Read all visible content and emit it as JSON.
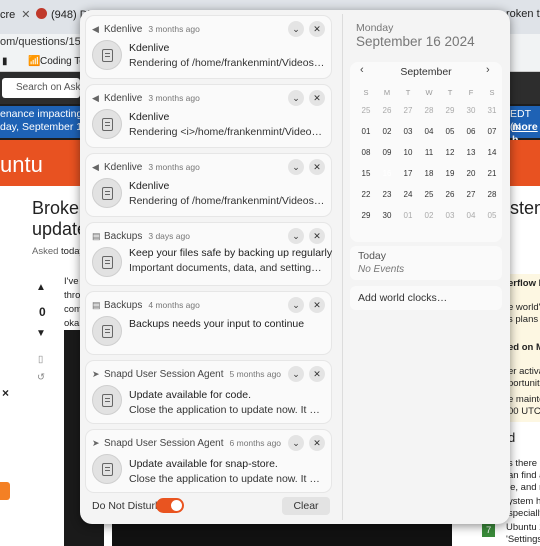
{
  "background": {
    "tabs": [
      {
        "label": "cre",
        "close": "✕"
      },
      {
        "label": "(948) Di"
      },
      {
        "label": "roken te"
      }
    ],
    "url_text": "om/questions/1527",
    "bookmark_coding": "Coding Te",
    "site_search": "Search on Ask Ub",
    "banner_line1": "enance impacting St",
    "banner_line2": "day, September 17, 2",
    "banner_right1": "EDT (N",
    "banner_right2": "more h",
    "ubuntu_text": "untu",
    "question_title_left1": "Broken",
    "question_title_left2": "update",
    "question_title_right": "stem",
    "asked_label": "Asked",
    "asked_value": "today",
    "vote_count": "0",
    "post_frag1": "I've",
    "post_frag2": "thro",
    "post_frag3": "com",
    "post_frag4": "oka",
    "side1a": "erflow B",
    "side1b": "e world's",
    "side1c": "s plans fo",
    "side2a": "ed on Me",
    "side3a": "er activa",
    "side3b": "portuniti",
    "side4a": "e mainte",
    "side4b": "00 UTC",
    "side5a": "d",
    "side6a": "s there a",
    "side6b": "an find a",
    "side6c": "le, and re",
    "side7a": "ystem ha",
    "side7b": "specially",
    "side8_count": "7",
    "side8a": "Ubuntu 24",
    "side8b": "'Settings'",
    "x_mark": "×"
  },
  "notifications": [
    {
      "app": "Kdenlive",
      "time": "3 months ago",
      "title": "Kdenlive",
      "body": "Rendering of /home/frankenmint/Videos/w4b...",
      "body2": ""
    },
    {
      "app": "Kdenlive",
      "time": "3 months ago",
      "title": "Kdenlive",
      "body": "Rendering <i>/home/frankenmint/Videos/w4b...",
      "body2": ""
    },
    {
      "app": "Kdenlive",
      "time": "3 months ago",
      "title": "Kdenlive",
      "body": "Rendering of /home/frankenmint/Videos/w4b...",
      "body2": ""
    },
    {
      "app": "Backups",
      "time": "3 days ago",
      "title": "Keep your files safe by backing up regularly",
      "body": "Important documents, data, and settings can ...",
      "body2": ""
    },
    {
      "app": "Backups",
      "time": "4 months ago",
      "title": "Backups needs your input to continue",
      "body": "",
      "body2": ""
    },
    {
      "app": "Snapd User Session Agent",
      "time": "5 months ago",
      "title": "Update available for code.",
      "body": "Close the application to update now. It will up...",
      "body2": ""
    },
    {
      "app": "Snapd User Session Agent",
      "time": "6 months ago",
      "title": "Update available for snap-store.",
      "body": "Close the application to update now. It will up...",
      "body2": ""
    }
  ],
  "footer": {
    "dnd_label": "Do Not Disturb",
    "clear_label": "Clear",
    "dnd_on": true
  },
  "calendar": {
    "day_name": "Monday",
    "full_date": "September 16 2024",
    "month": "September",
    "prev": "‹",
    "next": "›",
    "weekdays": [
      "S",
      "M",
      "T",
      "W",
      "T",
      "F",
      "S"
    ],
    "weeks": [
      [
        [
          "25",
          "other"
        ],
        [
          "26",
          "other"
        ],
        [
          "27",
          "other"
        ],
        [
          "28",
          "other"
        ],
        [
          "29",
          "other"
        ],
        [
          "30",
          "other"
        ],
        [
          "31",
          "other"
        ]
      ],
      [
        [
          "01",
          ""
        ],
        [
          "02",
          ""
        ],
        [
          "03",
          ""
        ],
        [
          "04",
          ""
        ],
        [
          "05",
          ""
        ],
        [
          "06",
          ""
        ],
        [
          "07",
          ""
        ]
      ],
      [
        [
          "08",
          ""
        ],
        [
          "09",
          ""
        ],
        [
          "10",
          ""
        ],
        [
          "11",
          ""
        ],
        [
          "12",
          ""
        ],
        [
          "13",
          ""
        ],
        [
          "14",
          ""
        ]
      ],
      [
        [
          "15",
          ""
        ],
        [
          "16",
          "today"
        ],
        [
          "17",
          ""
        ],
        [
          "18",
          ""
        ],
        [
          "19",
          ""
        ],
        [
          "20",
          ""
        ],
        [
          "21",
          ""
        ]
      ],
      [
        [
          "22",
          ""
        ],
        [
          "23",
          ""
        ],
        [
          "24",
          ""
        ],
        [
          "25",
          ""
        ],
        [
          "26",
          ""
        ],
        [
          "27",
          ""
        ],
        [
          "28",
          ""
        ]
      ],
      [
        [
          "29",
          ""
        ],
        [
          "30",
          ""
        ],
        [
          "01",
          "other"
        ],
        [
          "02",
          "other"
        ],
        [
          "03",
          "other"
        ],
        [
          "04",
          "other"
        ],
        [
          "05",
          "other"
        ]
      ]
    ],
    "accent": "#e95420",
    "events_title": "Today",
    "events_empty": "No Events",
    "world_clocks": "Add world clocks…"
  }
}
